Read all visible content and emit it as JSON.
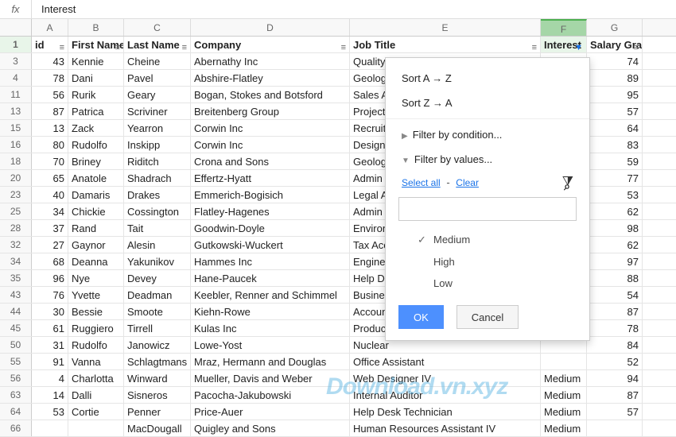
{
  "formula": "Interest",
  "columns": [
    "A",
    "B",
    "C",
    "D",
    "E",
    "F",
    "G"
  ],
  "selected_col": "F",
  "headers": [
    "id",
    "First Name",
    "Last Name",
    "Company",
    "Job Title",
    "Interest",
    "Salary Grade"
  ],
  "rows": [
    {
      "n": "1",
      "cells": [
        "id",
        "First Name",
        "Last Name",
        "Company",
        "Job Title",
        "Interest",
        "Salary Grade"
      ],
      "hdr": true
    },
    {
      "n": "3",
      "cells": [
        "43",
        "Kennie",
        "Cheine",
        "Abernathy Inc",
        "Quality",
        "",
        "74"
      ]
    },
    {
      "n": "4",
      "cells": [
        "78",
        "Dani",
        "Pavel",
        "Abshire-Flatley",
        "Geologist",
        "",
        "89"
      ]
    },
    {
      "n": "11",
      "cells": [
        "56",
        "Rurik",
        "Geary",
        "Bogan, Stokes and Botsford",
        "Sales Associate",
        "",
        "95"
      ]
    },
    {
      "n": "13",
      "cells": [
        "87",
        "Patrica",
        "Scriviner",
        "Breitenberg Group",
        "Project",
        "",
        "57"
      ]
    },
    {
      "n": "15",
      "cells": [
        "13",
        "Zack",
        "Yearron",
        "Corwin Inc",
        "Recruiter",
        "",
        "64"
      ]
    },
    {
      "n": "16",
      "cells": [
        "80",
        "Rudolfo",
        "Inskipp",
        "Corwin Inc",
        "Designer",
        "",
        "83"
      ]
    },
    {
      "n": "18",
      "cells": [
        "70",
        "Briney",
        "Riditch",
        "Crona and Sons",
        "Geologist",
        "",
        "59"
      ]
    },
    {
      "n": "20",
      "cells": [
        "65",
        "Anatole",
        "Shadrach",
        "Effertz-Hyatt",
        "Admin",
        "",
        "77"
      ]
    },
    {
      "n": "23",
      "cells": [
        "40",
        "Damaris",
        "Drakes",
        "Emmerich-Bogisich",
        "Legal Assistant",
        "",
        "53"
      ]
    },
    {
      "n": "25",
      "cells": [
        "34",
        "Chickie",
        "Cossington",
        "Flatley-Hagenes",
        "Admin",
        "",
        "62"
      ]
    },
    {
      "n": "28",
      "cells": [
        "37",
        "Rand",
        "Tait",
        "Goodwin-Doyle",
        "Environmental",
        "",
        "98"
      ]
    },
    {
      "n": "32",
      "cells": [
        "27",
        "Gaynor",
        "Alesin",
        "Gutkowski-Wuckert",
        "Tax Accountant",
        "",
        "62"
      ]
    },
    {
      "n": "34",
      "cells": [
        "68",
        "Deanna",
        "Yakunikov",
        "Hammes Inc",
        "Engineer",
        "",
        "97"
      ]
    },
    {
      "n": "35",
      "cells": [
        "96",
        "Nye",
        "Devey",
        "Hane-Paucek",
        "Help Desk",
        "",
        "88"
      ]
    },
    {
      "n": "43",
      "cells": [
        "76",
        "Yvette",
        "Deadman",
        "Keebler, Renner and Schimmel",
        "Business",
        "",
        "54"
      ]
    },
    {
      "n": "44",
      "cells": [
        "30",
        "Bessie",
        "Smoote",
        "Kiehn-Rowe",
        "Accountant",
        "",
        "87"
      ]
    },
    {
      "n": "45",
      "cells": [
        "61",
        "Ruggiero",
        "Tirrell",
        "Kulas Inc",
        "Product",
        "",
        "78"
      ]
    },
    {
      "n": "50",
      "cells": [
        "31",
        "Rudolfo",
        "Janowicz",
        "Lowe-Yost",
        "Nuclear",
        "",
        "84"
      ]
    },
    {
      "n": "55",
      "cells": [
        "91",
        "Vanna",
        "Schlagtmans",
        "Mraz, Hermann and Douglas",
        "Office Assistant",
        "",
        "52"
      ]
    },
    {
      "n": "56",
      "cells": [
        "4",
        "Charlotta",
        "Winward",
        "Mueller, Davis and Weber",
        "Web Designer IV",
        "Medium",
        "94"
      ]
    },
    {
      "n": "63",
      "cells": [
        "14",
        "Dalli",
        "Sisneros",
        "Pacocha-Jakubowski",
        "Internal Auditor",
        "Medium",
        "87"
      ]
    },
    {
      "n": "64",
      "cells": [
        "53",
        "Cortie",
        "Penner",
        "Price-Auer",
        "Help Desk Technician",
        "Medium",
        "57"
      ]
    },
    {
      "n": "66",
      "cells": [
        "",
        "",
        "MacDougall",
        "Quigley and Sons",
        "Human Resources Assistant IV",
        "Medium",
        ""
      ]
    }
  ],
  "popup": {
    "sort_az": "Sort A → Z",
    "sort_za": "Sort Z → A",
    "filter_cond": "Filter by condition...",
    "filter_vals": "Filter by values...",
    "select_all": "Select all",
    "clear": "Clear",
    "search_placeholder": "",
    "values": [
      {
        "label": "Medium",
        "checked": true
      },
      {
        "label": "High",
        "checked": false
      },
      {
        "label": "Low",
        "checked": false
      }
    ],
    "ok": "OK",
    "cancel": "Cancel"
  },
  "watermark": "Download.vn.xyz"
}
